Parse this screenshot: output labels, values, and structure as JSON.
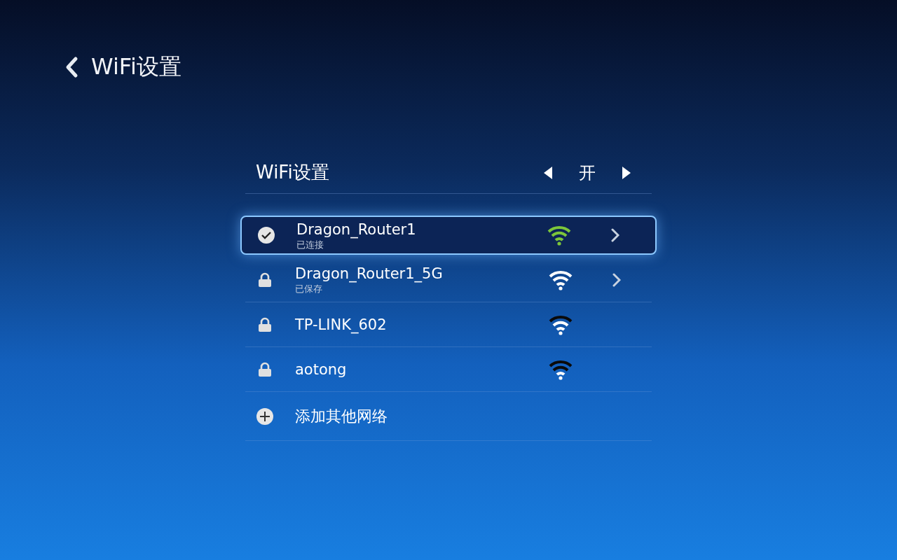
{
  "header": {
    "title": "WiFi设置"
  },
  "wifi_toggle": {
    "label": "WiFi设置",
    "value": "开"
  },
  "networks": [
    {
      "kind": "network",
      "name": "Dragon_Router1",
      "status": "已连接",
      "outer_arc_lit": true,
      "middle_arc_lit": true,
      "connected": true,
      "details": true,
      "selected": true
    },
    {
      "kind": "network",
      "name": "Dragon_Router1_5G",
      "status": "已保存",
      "outer_arc_lit": true,
      "middle_arc_lit": true,
      "connected": false,
      "details": true,
      "selected": false
    },
    {
      "kind": "network",
      "name": "TP-LINK_602",
      "outer_arc_lit": false,
      "middle_arc_lit": true,
      "connected": false,
      "details": false,
      "selected": false
    },
    {
      "kind": "network",
      "name": "aotong",
      "outer_arc_lit": false,
      "middle_arc_lit": false,
      "connected": false,
      "details": false,
      "selected": false
    },
    {
      "kind": "add",
      "name": "添加其他网络",
      "selected": false
    }
  ]
}
